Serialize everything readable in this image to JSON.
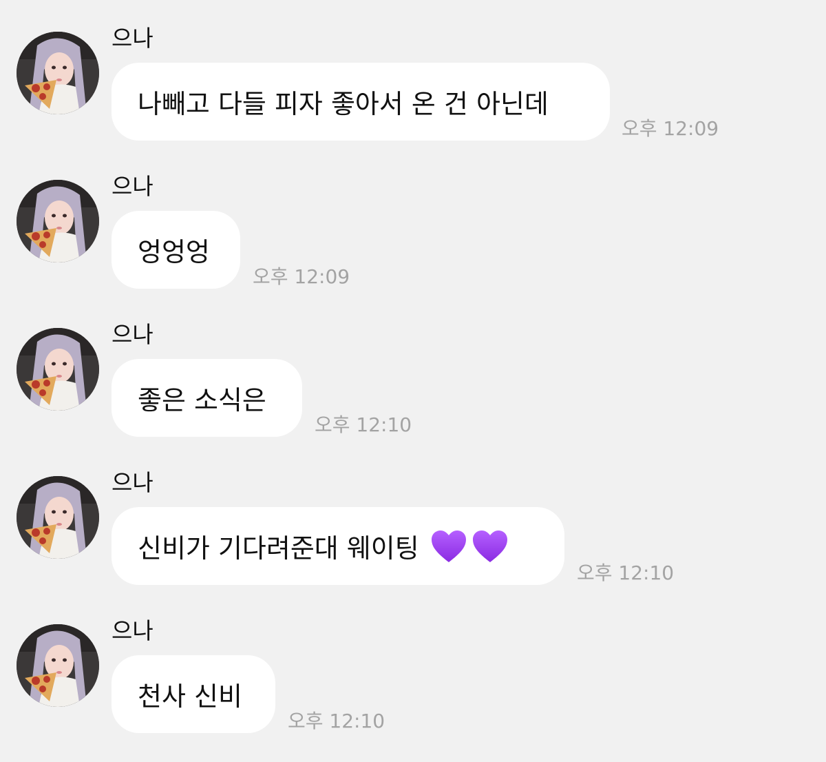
{
  "chat": {
    "messages": [
      {
        "sender": "으나",
        "text": "나빼고 다들 피자 좋아서 온 건 아닌데",
        "time": "오후 12:09"
      },
      {
        "sender": "으나",
        "text": "엉엉엉",
        "time": "오후 12:09"
      },
      {
        "sender": "으나",
        "text": "좋은 소식은",
        "time": "오후 12:10"
      },
      {
        "sender": "으나",
        "text": "신비가 기다려준대 웨이팅",
        "emoji": [
          "purple-heart",
          "purple-heart"
        ],
        "time": "오후 12:10"
      },
      {
        "sender": "으나",
        "text": "천사 신비",
        "time": "오후 12:10"
      }
    ]
  },
  "colors": {
    "background": "#f1f1f1",
    "bubble": "#ffffff",
    "timestamp": "#a3a3a3",
    "heart": "#9b3df0"
  }
}
